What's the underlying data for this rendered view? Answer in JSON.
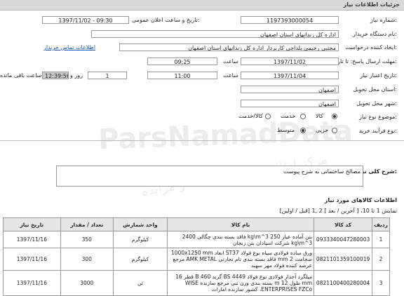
{
  "window": {
    "title": "جزئیات اطلاعات نیاز"
  },
  "form": {
    "need_number_label": "شماره نیاز:",
    "need_number": "1197393000054",
    "announce_label": "تاریخ و ساعت اعلان عمومی:",
    "announce_value": "1397/11/02 - 09:30",
    "buyer_org_label": "نام دستگاه خریدار:",
    "buyer_org": "اداره کل زندانهای استان اصفهان",
    "requester_label": "ایجاد کننده درخواست:",
    "requester": "مجتبی رحیمی بلداجی کاربردار اداره کل زندانهای استان اصفهان",
    "buyer_contact_link": "اطلاعات تماس خریدار",
    "send_deadline_label": "مهلت ارسال پاسخ: تا تاریخ:",
    "send_deadline_date": "1397/11/02",
    "send_deadline_time_label": "ساعت",
    "send_deadline_time": "09:25",
    "validity_label": "تاریخ اعتبار نیاز:",
    "validity_date": "1397/11/04",
    "validity_time_label": "ساعت",
    "validity_time": "11:00",
    "days_value": "1",
    "days_label": "روز و",
    "remaining_time": "12:39:56",
    "remaining_label": "ساعت باقی مانده",
    "province_label": "استان محل تحویل:",
    "province": "اصفهان",
    "city_label": "شهر محل تحویل:",
    "city": "اصفهان",
    "category_label": "موضوع نوع نیاز:",
    "category_options": [
      "کالا",
      "خدمت",
      "کالا/خدمت"
    ],
    "process_label": "نوع فرآیند خرید:",
    "process_options": [
      "جزیی",
      "متوسط"
    ]
  },
  "summary": {
    "label": "شرح کلی نیاز:",
    "value": "مصالح ساختمانی به شرح پیوست"
  },
  "items_section": {
    "title": "اطلاعات کالاهای مورد نیاز",
    "pagination": "نمایش 1 تا 10، [ آخرین / بعد ] 2 ,1 [قبل / اولین]",
    "headers": [
      "ردیف",
      "کد کالا",
      "نام کالا",
      "واحد شمارش",
      "تعداد / مقدار",
      "تاریخ نیاز"
    ],
    "rows": [
      {
        "row": "1",
        "code": "0933340047280003",
        "name": "بتن آماده عیار kg\\m^3 250 فاقد بسته بندی چگالی 2400 kg\\m^3 شرکت اسپادان بتن زنجان",
        "unit": "کیلوگرم",
        "qty": "350",
        "date": "1397/11/16"
      },
      {
        "row": "2",
        "code": "0821101359100019",
        "name": "ورق ساده فولادی سیاه نوع فولاد ST37 ابعاد 1000x1250 mm ضخامت 2 mm فاقد بسته بندی نام تجارتی AMK METAL مرجع عرضه کننده فولاد مهر سهند",
        "unit": "کیلوگرم",
        "qty": "300",
        "date": "1397/11/16"
      },
      {
        "row": "3",
        "code": "0821100400280004",
        "name": "میلگرد آجدار فولادی نوع فولاد BS 4449 گرید 460 B قطر 16 mm طول 12 m بسته بندی وزن تنی مرجع سازنده WISE ENTERPRISES FZCo، کشور سازنده امارات",
        "unit": "تن",
        "qty": "3000",
        "date": "1397/11/16"
      }
    ]
  },
  "watermark": {
    "line1": "ParsNamadData",
    "line2": "مرکز اطلاع رسانی مناقصه و مزایده"
  }
}
